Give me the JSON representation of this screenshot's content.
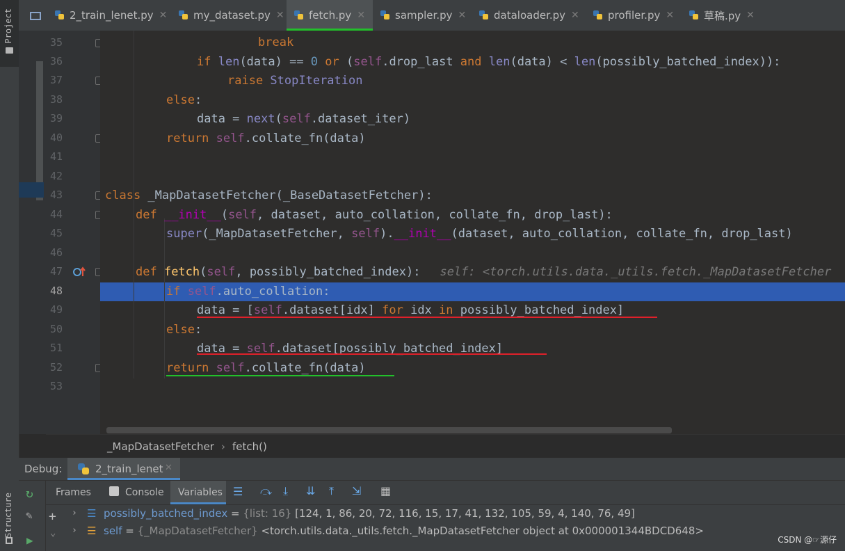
{
  "sidebar": {
    "project": "Project",
    "structure": "Structure"
  },
  "tabs": [
    {
      "label": "2_train_lenet.py"
    },
    {
      "label": "my_dataset.py"
    },
    {
      "label": "fetch.py"
    },
    {
      "label": "sampler.py"
    },
    {
      "label": "dataloader.py"
    },
    {
      "label": "profiler.py"
    },
    {
      "label": "草稿.py"
    }
  ],
  "active_tab": "fetch.py",
  "lines": [
    "35",
    "36",
    "37",
    "38",
    "39",
    "40",
    "41",
    "42",
    "43",
    "44",
    "45",
    "46",
    "47",
    "48",
    "49",
    "50",
    "51",
    "52",
    "53"
  ],
  "code": {
    "l35_kw": "break",
    "l36_a": "if ",
    "l36_b": "len",
    "l36_c": "(data) == ",
    "l36_d": "0",
    "l36_e": " or ",
    "l36_f": "(",
    "l36_g": "self",
    "l36_h": ".drop_last ",
    "l36_i": "and ",
    "l36_j": "len",
    "l36_k": "(data) < ",
    "l36_l": "len",
    "l36_m": "(possibly_batched_index)):",
    "l37_a": "raise ",
    "l37_b": "StopIteration",
    "l38_a": "else",
    "l39_a": "data = ",
    "l39_b": "next",
    "l39_c": "(",
    "l39_d": "self",
    "l39_e": ".dataset_iter)",
    "l40_a": "return ",
    "l40_b": "self",
    "l40_c": ".collate_fn(data)",
    "l43_a": "class ",
    "l43_b": "_MapDatasetFetcher(_BaseDatasetFetcher):",
    "l44_a": "def ",
    "l44_b": "__init__",
    "l44_c": "(",
    "l44_d": "self",
    "l44_e": ", dataset, auto_collation, collate_fn, drop_last):",
    "l45_a": "super",
    "l45_b": "(_MapDatasetFetcher, ",
    "l45_c": "self",
    "l45_d": ").",
    "l45_e": "__init__",
    "l45_f": "(dataset, auto_collation, collate_fn, drop_last)",
    "l47_a": "def ",
    "l47_b": "fetch",
    "l47_c": "(",
    "l47_d": "self",
    "l47_e": ", possibly_batched_index):",
    "l47_hint": "self: <torch.utils.data._utils.fetch._MapDatasetFetcher",
    "l48_a": "if ",
    "l48_b": "self",
    "l48_c": ".auto_collation:",
    "l49_a": "data = [",
    "l49_b": "self",
    "l49_c": ".dataset[idx] ",
    "l49_d": "for ",
    "l49_e": "idx ",
    "l49_f": "in ",
    "l49_g": "possibly_batched_index]",
    "l50_a": "else",
    "l51_a": "data = ",
    "l51_b": "self",
    "l51_c": ".dataset[possibly_batched_index]",
    "l52_a": "return ",
    "l52_b": "self",
    "l52_c": ".collate_fn(data)"
  },
  "breadcrumb": {
    "class": "_MapDatasetFetcher",
    "sep": "›",
    "method": "fetch()"
  },
  "debug": {
    "label": "Debug:",
    "session": "2_train_lenet",
    "tabs": {
      "frames": "Frames",
      "console": "Console",
      "variables": "Variables"
    },
    "vars": [
      {
        "name": "possibly_batched_index",
        "eq": " = ",
        "type": "{list: 16} ",
        "value": "[124, 1, 86, 20, 72, 116, 15, 17, 41, 132, 105, 59, 4, 140, 76, 49]"
      },
      {
        "name": "self",
        "eq": " = ",
        "type": "{_MapDatasetFetcher} ",
        "value": "<torch.utils.data._utils.fetch._MapDatasetFetcher object at 0x000001344BDCD648>"
      }
    ]
  },
  "watermark": "CSDN @☞源仔",
  "colors": {
    "accent_green": "#22c02b",
    "underline_red": "#e0202a",
    "selection": "#2f65ca"
  }
}
